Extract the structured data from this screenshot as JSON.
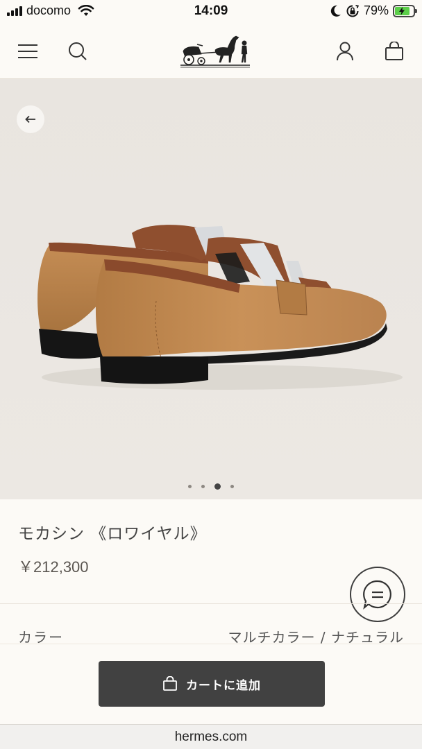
{
  "status_bar": {
    "carrier": "docomo",
    "time": "14:09",
    "battery_percent": "79%",
    "battery_level": 0.79,
    "icons": [
      "signal-icon",
      "wifi-icon",
      "moon-icon",
      "orientation-lock-icon",
      "battery-charging-icon"
    ]
  },
  "header": {
    "icons": [
      "menu-icon",
      "search-icon",
      "hermes-logo",
      "account-icon",
      "shopping-bag-icon"
    ]
  },
  "gallery": {
    "image": "brown-leather-loafer-with-fringe",
    "slide_count": 4,
    "active_slide": 3,
    "back_icon": "arrow-left-icon"
  },
  "product": {
    "name": "モカシン 《ロワイヤル》",
    "price": "￥212,300",
    "color_label": "カラー",
    "color_value": "マルチカラー / ナチュラル"
  },
  "chat": {
    "icon": "chat-bubble-icon"
  },
  "cart": {
    "add_label": "カートに追加",
    "icon": "shopping-bag-icon"
  },
  "browser": {
    "url": "hermes.com"
  },
  "colors": {
    "background": "#fcfaf6",
    "hero_background": "#ebe7e2",
    "button_dark": "#414141",
    "shoe_tan": "#b07a45",
    "shoe_brown": "#8a4a2c",
    "battery_green": "#5ccf4a"
  }
}
